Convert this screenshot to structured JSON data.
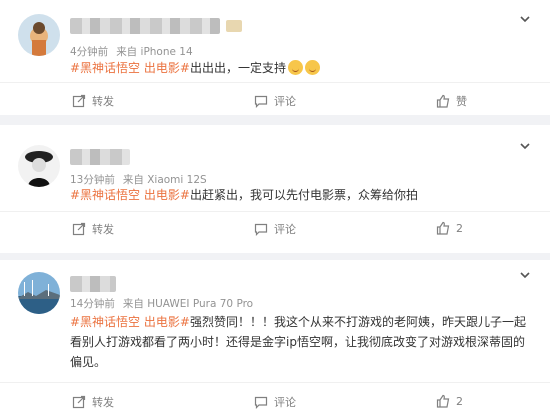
{
  "posts": [
    {
      "meta": {
        "time": "4分钟前",
        "source": "来自 iPhone 14"
      },
      "hashtag": "#黑神话悟空 出电影#",
      "body": "出出出，一定支持",
      "emoji": [
        "emoji-face",
        "emoji-face"
      ],
      "actions": {
        "repost": "转发",
        "comment": "评论",
        "like": "赞"
      }
    },
    {
      "meta": {
        "time": "13分钟前",
        "source": "来自 Xiaomi 12S"
      },
      "hashtag": "#黑神话悟空 出电影#",
      "body": "出赶紧出，我可以先付电影票，众筹给你拍",
      "actions": {
        "repost": "转发",
        "comment": "评论",
        "like": "2"
      }
    },
    {
      "meta": {
        "time": "14分钟前",
        "source": "来自 HUAWEI Pura 70 Pro"
      },
      "hashtag": "#黑神话悟空 出电影#",
      "body": "强烈赞同！！！我这个从来不打游戏的老阿姨，昨天跟儿子一起看别人打游戏都看了两小时！还得是金字ip悟空啊，让我彻底改变了对游戏根深蒂固的偏见。",
      "actions": {
        "repost": "转发",
        "comment": "评论",
        "like": "2"
      }
    }
  ],
  "colors": {
    "hashtag": "#eb7340",
    "meta": "#939393",
    "action": "#808080"
  }
}
